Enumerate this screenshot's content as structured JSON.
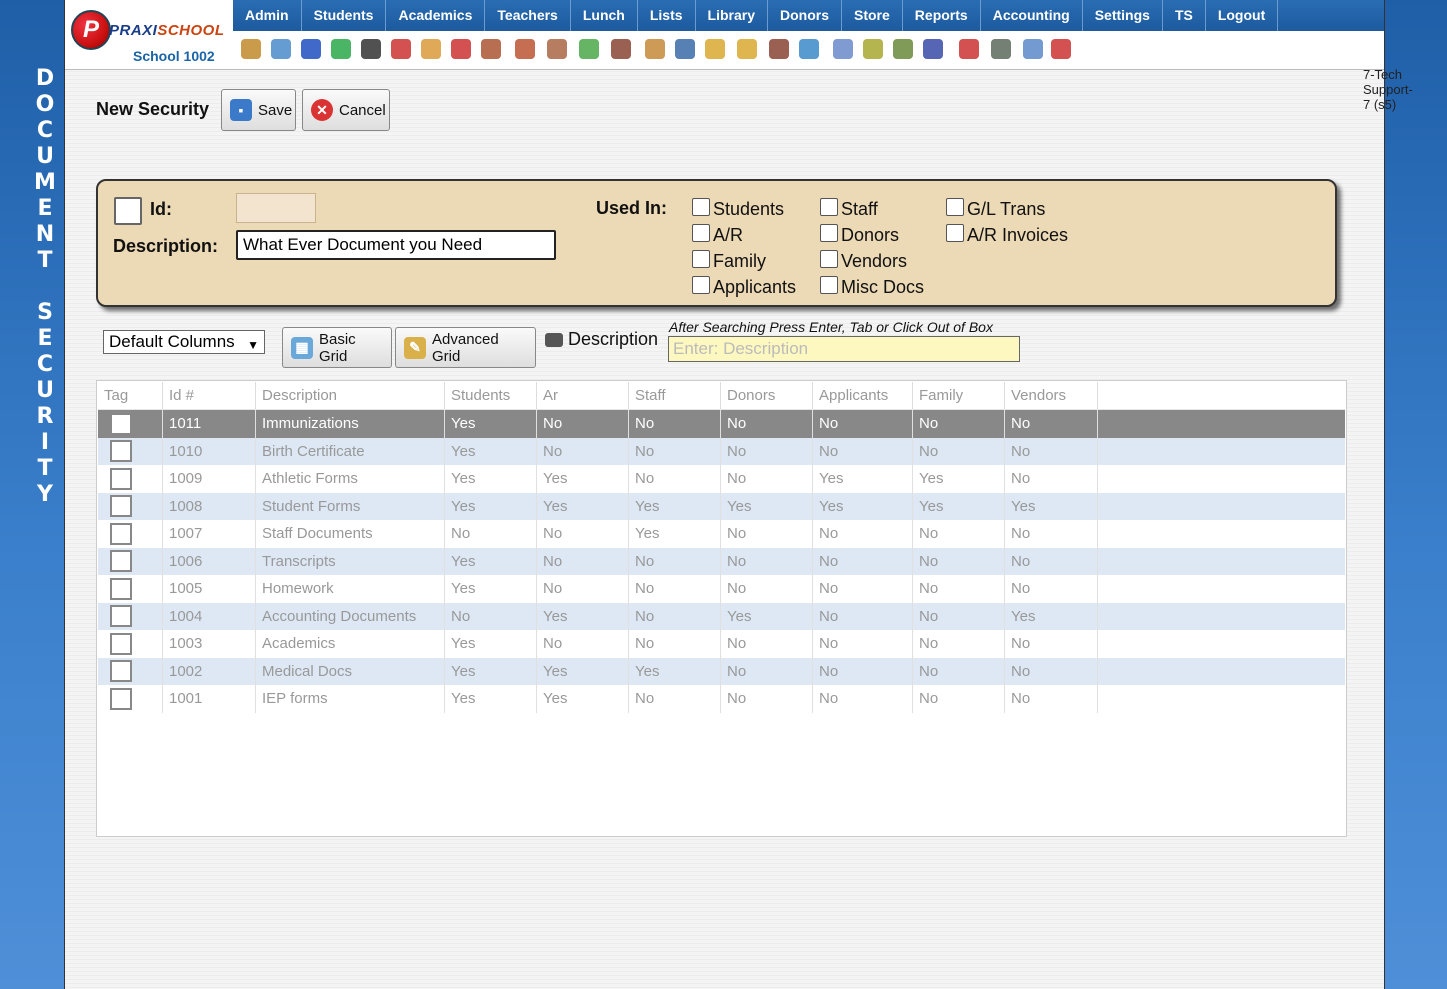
{
  "side_title": [
    "D",
    "O",
    "C",
    "U",
    "M",
    "E",
    "N",
    "T",
    "",
    "S",
    "E",
    "C",
    "U",
    "R",
    "I",
    "T",
    "Y"
  ],
  "logo": {
    "brand_left": "PRAXI",
    "brand_right": "SCHOOL",
    "school": "School 1002"
  },
  "nav": [
    "Admin",
    "Students",
    "Academics",
    "Teachers",
    "Lunch",
    "Lists",
    "Library",
    "Donors",
    "Store",
    "Reports",
    "Accounting",
    "Settings",
    "TS",
    "Logout"
  ],
  "toolbar_icons": [
    {
      "name": "search-icon",
      "color": "#c08a2a"
    },
    {
      "name": "grid-icon",
      "color": "#4a8bc9"
    },
    {
      "name": "email-icon",
      "color": "#1f4fbf"
    },
    {
      "name": "chat-icon",
      "color": "#2aa84a"
    },
    {
      "name": "phone-icon",
      "color": "#333333"
    },
    {
      "name": "mute-icon",
      "color": "#cc3333"
    },
    {
      "name": "notes-icon",
      "color": "#d99a3a"
    },
    {
      "name": "calendar-icon",
      "color": "#cc3333"
    },
    {
      "name": "megaphone-icon",
      "color": "#aa5533"
    },
    {
      "name": "student-add-icon",
      "color": "#bb5533"
    },
    {
      "name": "student-icon",
      "color": "#aa6644"
    },
    {
      "name": "money-icon",
      "color": "#4aa84a"
    },
    {
      "name": "family-icon",
      "color": "#884433"
    },
    {
      "name": "lunch-icon",
      "color": "#c58a3a"
    },
    {
      "name": "book-icon",
      "color": "#3a6aa8"
    },
    {
      "name": "bell-icon",
      "color": "#d9a830"
    },
    {
      "name": "export-icon",
      "color": "#d9a830"
    },
    {
      "name": "staff-icon",
      "color": "#884433"
    },
    {
      "name": "clock-icon",
      "color": "#3a8ac9"
    },
    {
      "name": "report-icon",
      "color": "#6a8ac9"
    },
    {
      "name": "card-icon",
      "color": "#a8a830"
    },
    {
      "name": "printer-icon",
      "color": "#6a8a3a"
    },
    {
      "name": "ap-icon",
      "color": "#3a4aa8"
    },
    {
      "name": "pdf-icon",
      "color": "#cc3333"
    },
    {
      "name": "cash-icon",
      "color": "#5a6a5a"
    },
    {
      "name": "help-icon",
      "color": "#5a8ac9"
    },
    {
      "name": "stop-icon",
      "color": "#cc3333"
    }
  ],
  "user_label": "7-Tech Support-7 (s5)",
  "form": {
    "title": "New Security",
    "save_label": "Save",
    "cancel_label": "Cancel",
    "id_label": "Id:",
    "id_value": "",
    "description_label": "Description:",
    "description_value": "What Ever Document you Need",
    "used_in_label": "Used In:",
    "used_in_options": [
      "Students",
      "A/R",
      "Family",
      "Applicants",
      "Staff",
      "Donors",
      "Vendors",
      "Misc Docs",
      "G/L Trans",
      "A/R Invoices"
    ]
  },
  "grid_controls": {
    "columns_select": "Default Columns",
    "basic_grid_label": "Basic Grid",
    "advanced_grid_label": "Advanced Grid",
    "search_field_label": "Description",
    "search_hint": "After Searching Press Enter, Tab or Click Out of Box",
    "search_placeholder": "Enter: Description"
  },
  "table": {
    "columns": [
      "Tag",
      "Id #",
      "Description",
      "Students",
      "Ar",
      "Staff",
      "Donors",
      "Applicants",
      "Family",
      "Vendors"
    ],
    "rows": [
      [
        "1011",
        "Immunizations",
        "Yes",
        "No",
        "No",
        "No",
        "No",
        "No",
        "No"
      ],
      [
        "1010",
        "Birth Certificate",
        "Yes",
        "No",
        "No",
        "No",
        "No",
        "No",
        "No"
      ],
      [
        "1009",
        "Athletic Forms",
        "Yes",
        "Yes",
        "No",
        "No",
        "Yes",
        "Yes",
        "No"
      ],
      [
        "1008",
        "Student Forms",
        "Yes",
        "Yes",
        "Yes",
        "Yes",
        "Yes",
        "Yes",
        "Yes"
      ],
      [
        "1007",
        "Staff Documents",
        "No",
        "No",
        "Yes",
        "No",
        "No",
        "No",
        "No"
      ],
      [
        "1006",
        "Transcripts",
        "Yes",
        "No",
        "No",
        "No",
        "No",
        "No",
        "No"
      ],
      [
        "1005",
        "Homework",
        "Yes",
        "No",
        "No",
        "No",
        "No",
        "No",
        "No"
      ],
      [
        "1004",
        "Accounting Documents",
        "No",
        "Yes",
        "No",
        "Yes",
        "No",
        "No",
        "Yes"
      ],
      [
        "1003",
        "Academics",
        "Yes",
        "No",
        "No",
        "No",
        "No",
        "No",
        "No"
      ],
      [
        "1002",
        "Medical Docs",
        "Yes",
        "Yes",
        "Yes",
        "No",
        "No",
        "No",
        "No"
      ],
      [
        "1001",
        "IEP forms",
        "Yes",
        "Yes",
        "No",
        "No",
        "No",
        "No",
        "No"
      ]
    ],
    "selected_row": 0
  }
}
